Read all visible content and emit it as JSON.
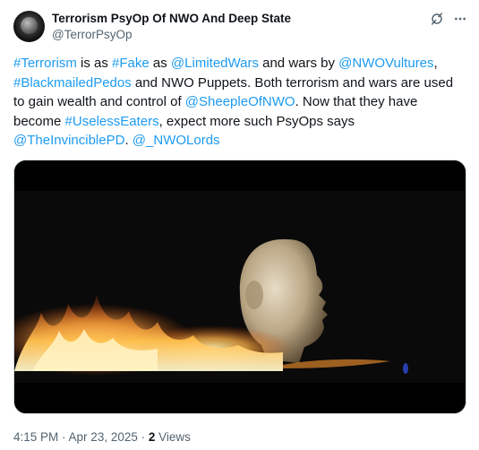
{
  "author": {
    "display_name": "Terrorism PsyOp Of NWO And Deep State",
    "handle": "@TerrorPsyOp",
    "avatar_icon": "globe-avatar-icon"
  },
  "header_actions": {
    "grok_icon": "grok-icon",
    "more_icon": "more-horizontal-icon"
  },
  "tweet": {
    "segments": [
      {
        "text": "#Terrorism",
        "type": "hashtag"
      },
      {
        "text": " is as ",
        "type": "text"
      },
      {
        "text": "#Fake",
        "type": "hashtag"
      },
      {
        "text": " as ",
        "type": "text"
      },
      {
        "text": "@LimitedWars",
        "type": "mention"
      },
      {
        "text": " and wars by ",
        "type": "text"
      },
      {
        "text": "@NWOVultures",
        "type": "mention"
      },
      {
        "text": ", ",
        "type": "text"
      },
      {
        "text": "#BlackmailedPedos",
        "type": "hashtag"
      },
      {
        "text": " and NWO Puppets. Both terrorism and wars are used to gain wealth and control of ",
        "type": "text"
      },
      {
        "text": "@SheepleOfNWO",
        "type": "mention"
      },
      {
        "text": ". Now that they have become ",
        "type": "text"
      },
      {
        "text": "#UselessEaters",
        "type": "hashtag"
      },
      {
        "text": ", expect more such PsyOps says ",
        "type": "text"
      },
      {
        "text": "@TheInvinciblePD",
        "type": "mention"
      },
      {
        "text": ". ",
        "type": "text"
      },
      {
        "text": "@_NWOLords",
        "type": "mention"
      }
    ]
  },
  "media": {
    "description": "video-frame-mannequin-head-flames"
  },
  "footer": {
    "time": "4:15 PM",
    "separator": " · ",
    "date": "Apr 23, 2025",
    "views_count": "2",
    "views_label": "Views"
  },
  "colors": {
    "link": "#1d9bf0",
    "secondary_text": "#536471",
    "primary_text": "#0f1419",
    "border": "#cfd9de"
  }
}
